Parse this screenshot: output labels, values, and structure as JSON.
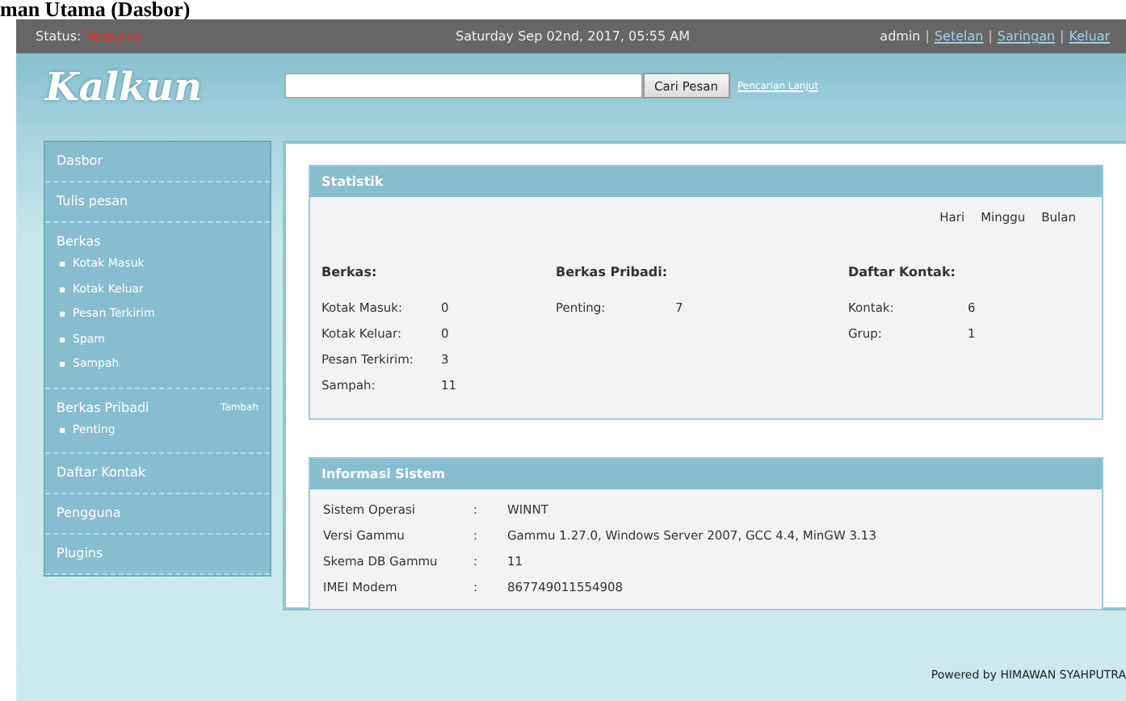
{
  "caption": "man Utama (Dasbor)",
  "top_bar": {
    "status_label": "Status:",
    "status_value": "Terputus",
    "datetime": "Saturday Sep 02nd, 2017, 05:55 AM",
    "user": "admin",
    "separator": "|",
    "links": [
      "Setelan",
      "Saringan",
      "Keluar"
    ]
  },
  "header": {
    "logo": "Kalkun",
    "search": {
      "button": "Cari Pesan",
      "advanced_link": "Pencarian Lanjut"
    }
  },
  "sidebar": {
    "sections": [
      {
        "label": "Dasbor"
      },
      {
        "label": "Tulis pesan"
      },
      {
        "label": "Berkas",
        "children": [
          "Kotak Masuk",
          "Kotak Keluar",
          "Pesan Terkirim",
          "Spam",
          "Sampah"
        ]
      },
      {
        "label": "Berkas Pribadi",
        "action": "Tambah",
        "children": [
          "Penting"
        ]
      },
      {
        "label": "Daftar Kontak"
      },
      {
        "label": "Pengguna"
      },
      {
        "label": "Plugins"
      }
    ]
  },
  "statistik": {
    "title": "Statistik",
    "periods": [
      "Hari",
      "Minggu",
      "Bulan"
    ],
    "groups": [
      {
        "title": "Berkas:",
        "rows": [
          {
            "label": "Kotak Masuk:",
            "value": "0"
          },
          {
            "label": "Kotak Keluar:",
            "value": "0"
          },
          {
            "label": "Pesan Terkirim:",
            "value": "3"
          },
          {
            "label": "Sampah:",
            "value": "11"
          }
        ]
      },
      {
        "title": "Berkas Pribadi:",
        "rows": [
          {
            "label": "Penting:",
            "value": "7"
          }
        ]
      },
      {
        "title": "Daftar Kontak:",
        "rows": [
          {
            "label": "Kontak:",
            "value": "6"
          },
          {
            "label": "Grup:",
            "value": "1"
          }
        ]
      }
    ]
  },
  "informasi_sistem": {
    "title": "Informasi Sistem",
    "rows": [
      {
        "label": "Sistem Operasi",
        "separator": ":",
        "value": "WINNT"
      },
      {
        "label": "Versi Gammu",
        "separator": ":",
        "value": "Gammu 1.27.0, Windows Server 2007, GCC 4.4, MinGW 3.13"
      },
      {
        "label": "Skema DB Gammu",
        "separator": ":",
        "value": "11"
      },
      {
        "label": "IMEI Modem",
        "separator": ":",
        "value": "867749011554908"
      }
    ]
  },
  "footer": "Powered by HIMAWAN SYAHPUTRA"
}
